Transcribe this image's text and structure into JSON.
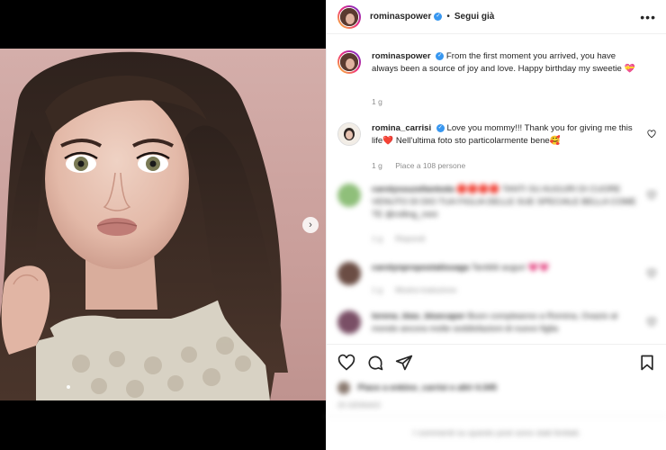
{
  "post": {
    "author": "rominaspower",
    "follow_label": "Segui già",
    "separator": "•",
    "caption_author": "rominaspower",
    "caption_text": "From the first moment you arrived, you have always been a source of joy and love. Happy birthday my sweetie 💝",
    "caption_time": "1 g"
  },
  "comments": [
    {
      "author": "romina_carrisi",
      "text": "Love you mommy!!! Thank you for giving me this life❤️  Nell'ultima foto sto particolarmente bene🥰",
      "time": "1 g",
      "likes": "Piace a 108 persone"
    },
    {
      "author": "carolyssuzellantoda",
      "text": "🔴🔴🔴🔴 TANTI SU AUGURI DI CUORE VENUTO DI DIO TUA FIGLIA DELLE SUE SPECIALE BELLA COME TE @rolling_mini",
      "time": "1 g",
      "likes": "Rispondi"
    },
    {
      "author": "carolynpropostatissaga",
      "text": "Tantiiiiii auguri 💗💗",
      "time": "1 g",
      "likes": "Mostra traduzione"
    },
    {
      "author": "lorena_bias_bluecaper",
      "text": "Buon compleanno a Romina, Ovazio al mondo ancora molte soddisfazioni di nuovo figlia",
      "time": "1 g",
      "likes": ""
    }
  ],
  "footer": {
    "likes_text": "Piace a enkino_carrisi e altri 4.345",
    "time_text": "25 GENNAIO",
    "limited_text": "I commenti su questo post sono stati limitati."
  },
  "icons": {
    "next": "chevron-right-icon",
    "like": "heart-icon",
    "comment": "comment-icon",
    "share": "paper-plane-icon",
    "save": "bookmark-icon",
    "more": "more-horizontal-icon"
  },
  "colors": {
    "verified": "#3897f0",
    "muted": "#8e8e8e",
    "border": "#efefef",
    "photo_background": "#cfa9a5"
  }
}
